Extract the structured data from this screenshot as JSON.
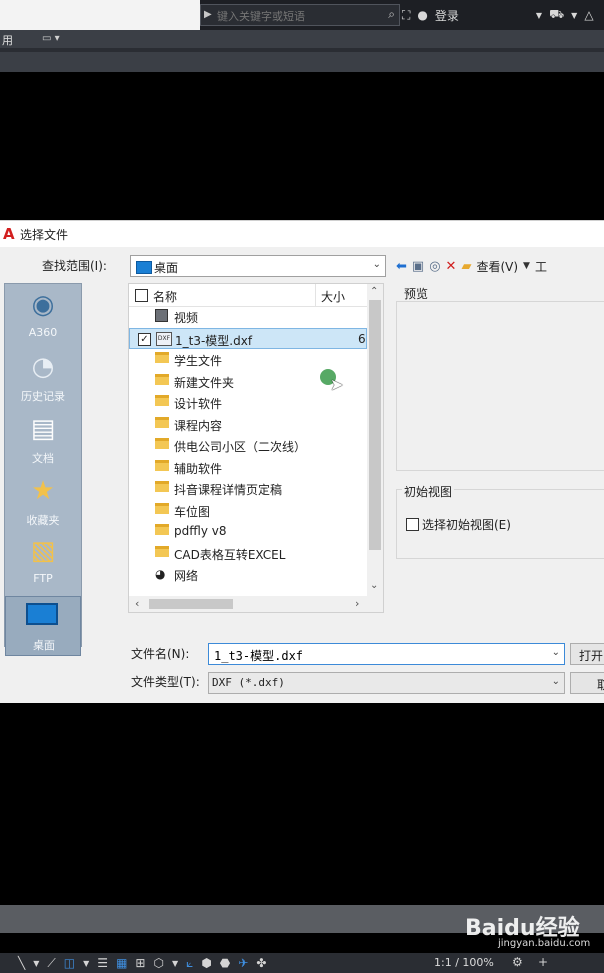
{
  "top": {
    "search_placeholder": "键入关键字或短语",
    "login_label": "登录",
    "ribbon_left": "用"
  },
  "dialog": {
    "title": "选择文件",
    "look_in_label": "查找范围(I):",
    "look_in_value": "桌面",
    "toolbar": {
      "views_label": "查看(V)",
      "tools_label": "工"
    },
    "places": [
      {
        "label": "A360",
        "icon": "cloud-icon"
      },
      {
        "label": "历史记录",
        "icon": "history-icon"
      },
      {
        "label": "文档",
        "icon": "document-icon"
      },
      {
        "label": "收藏夹",
        "icon": "favorites-icon"
      },
      {
        "label": "FTP",
        "icon": "ftp-icon"
      },
      {
        "label": "桌面",
        "icon": "desktop-icon"
      }
    ],
    "columns": {
      "name": "名称",
      "size": "大小"
    },
    "files": [
      {
        "name": "视频",
        "type": "video"
      },
      {
        "name": "1_t3-模型.dxf",
        "type": "dxf",
        "size": "6",
        "selected": true
      },
      {
        "name": "学生文件",
        "type": "folder"
      },
      {
        "name": "新建文件夹",
        "type": "folder"
      },
      {
        "name": "设计软件",
        "type": "folder"
      },
      {
        "name": "课程内容",
        "type": "folder"
      },
      {
        "name": "供电公司小区（二次线）",
        "type": "folder"
      },
      {
        "name": "辅助软件",
        "type": "folder"
      },
      {
        "name": "抖音课程详情页定稿",
        "type": "folder"
      },
      {
        "name": "车位图",
        "type": "folder"
      },
      {
        "name": "pdffly v8",
        "type": "folder"
      },
      {
        "name": "CAD表格互转EXCEL",
        "type": "folder"
      },
      {
        "name": "网络",
        "type": "network"
      }
    ],
    "preview_label": "预览",
    "initial_view_group": "初始视图",
    "initial_view_checkbox": "选择初始视图(E)",
    "file_name_label": "文件名(N):",
    "file_name_value": "1_t3-模型.dxf",
    "file_type_label": "文件类型(T):",
    "file_type_value": "DXF (*.dxf)",
    "open_button": "打开",
    "cancel_button": "取"
  },
  "status": {
    "zoom": "1:1 / 100%"
  },
  "watermark": {
    "logo": "Baidu经验",
    "url": "jingyan.baidu.com"
  },
  "colors": {
    "accent": "#1a7fd4",
    "selection": "#cde6f7",
    "places_bg": "#a9b8c8",
    "folder": "#f3c754"
  }
}
